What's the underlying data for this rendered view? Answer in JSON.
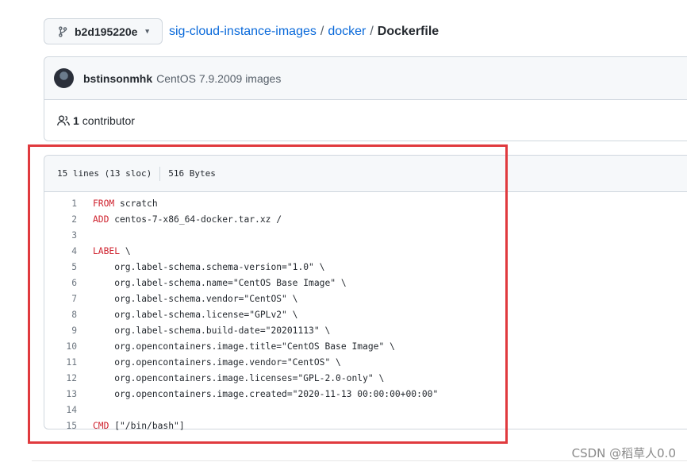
{
  "branch": {
    "name": "b2d195220e",
    "caret": "▾"
  },
  "breadcrumb": {
    "repo": "sig-cloud-instance-images",
    "sep": "/",
    "folder": "docker",
    "file": "Dockerfile"
  },
  "commit": {
    "author": "bstinsonmhk",
    "message": "CentOS 7.9.2009 images"
  },
  "contributors": {
    "count": "1",
    "label": "contributor"
  },
  "file": {
    "lines": "15 lines (13 sloc)",
    "size": "516 Bytes"
  },
  "code": [
    {
      "n": "1",
      "kw": "FROM",
      "text": " scratch"
    },
    {
      "n": "2",
      "kw": "ADD",
      "text": " centos-7-x86_64-docker.tar.xz /"
    },
    {
      "n": "3",
      "kw": "",
      "text": ""
    },
    {
      "n": "4",
      "kw": "LABEL",
      "text": " \\"
    },
    {
      "n": "5",
      "kw": "",
      "text": "    org.label-schema.schema-version=\"1.0\" \\"
    },
    {
      "n": "6",
      "kw": "",
      "text": "    org.label-schema.name=\"CentOS Base Image\" \\"
    },
    {
      "n": "7",
      "kw": "",
      "text": "    org.label-schema.vendor=\"CentOS\" \\"
    },
    {
      "n": "8",
      "kw": "",
      "text": "    org.label-schema.license=\"GPLv2\" \\"
    },
    {
      "n": "9",
      "kw": "",
      "text": "    org.label-schema.build-date=\"20201113\" \\"
    },
    {
      "n": "10",
      "kw": "",
      "text": "    org.opencontainers.image.title=\"CentOS Base Image\" \\"
    },
    {
      "n": "11",
      "kw": "",
      "text": "    org.opencontainers.image.vendor=\"CentOS\" \\"
    },
    {
      "n": "12",
      "kw": "",
      "text": "    org.opencontainers.image.licenses=\"GPL-2.0-only\" \\"
    },
    {
      "n": "13",
      "kw": "",
      "text": "    org.opencontainers.image.created=\"2020-11-13 00:00:00+00:00\""
    },
    {
      "n": "14",
      "kw": "",
      "text": ""
    },
    {
      "n": "15",
      "kw": "CMD",
      "text": " [\"/bin/bash\"]"
    }
  ],
  "watermark": "CSDN @稻草人0.0",
  "colors": {
    "link": "#0969da",
    "keyword": "#cf222e",
    "highlight_border": "#e03a3e"
  }
}
